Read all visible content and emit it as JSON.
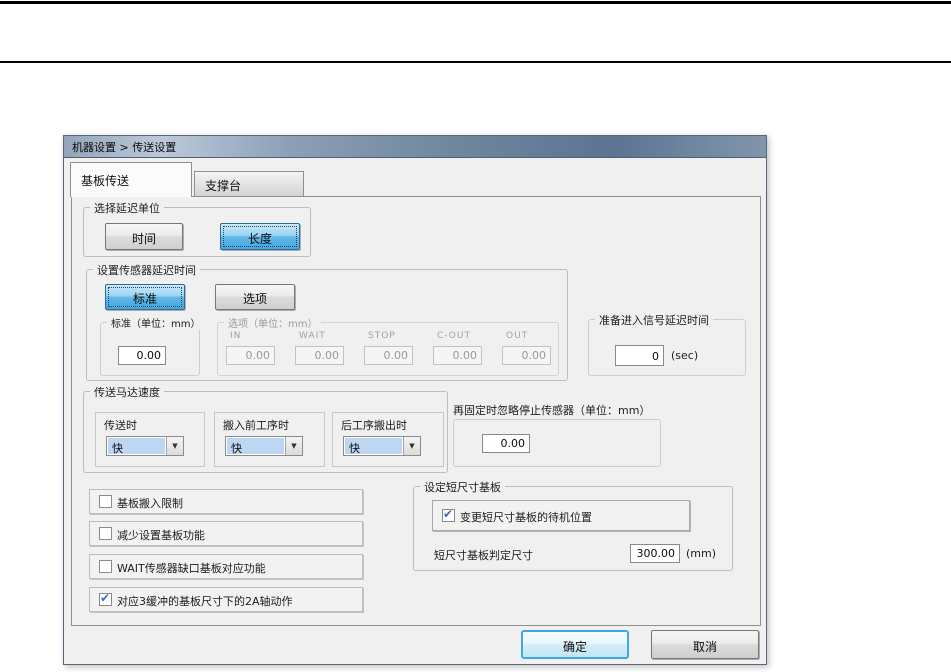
{
  "window": {
    "title": "机器设置 > 传送设置",
    "tabs": {
      "board_transfer": "基板传送",
      "support_table": "支撑台"
    }
  },
  "delay_unit_group": {
    "title": "选择延迟单位",
    "time_button": "时间",
    "length_button": "长度"
  },
  "sensor_delay_group": {
    "title": "设置传感器延迟时间",
    "standard_button": "标准",
    "option_button": "选项",
    "standard_sub": {
      "title": "标准（单位：mm）",
      "value": "0.00"
    },
    "option_sub": {
      "title": "选项（单位：mm）",
      "fields": [
        {
          "label": "IN",
          "value": "0.00"
        },
        {
          "label": "WAIT",
          "value": "0.00"
        },
        {
          "label": "STOP",
          "value": "0.00"
        },
        {
          "label": "C-OUT",
          "value": "0.00"
        },
        {
          "label": "OUT",
          "value": "0.00"
        }
      ]
    }
  },
  "ready_signal_group": {
    "title": "准备进入信号延迟时间",
    "value": "0",
    "unit": "(sec)"
  },
  "motor_speed_group": {
    "title": "传送马达速度",
    "dropdowns": [
      {
        "label": "传送时",
        "value": "快"
      },
      {
        "label": "搬入前工序时",
        "value": "快"
      },
      {
        "label": "后工序搬出时",
        "value": "快"
      }
    ],
    "dropdown_arrow": "▼"
  },
  "refix_group": {
    "title": "再固定时忽略停止传感器（单位：mm）",
    "value": "0.00"
  },
  "checkboxes": [
    {
      "label": "基板搬入限制",
      "checked": false
    },
    {
      "label": "减少设置基板功能",
      "checked": false
    },
    {
      "label": "WAIT传感器缺口基板对应功能",
      "checked": false
    },
    {
      "label": "对应3缓冲的基板尺寸下的2A轴动作",
      "checked": true
    }
  ],
  "short_board_group": {
    "title": "设定短尺寸基板",
    "standby_checkbox": {
      "label": "变更短尺寸基板的待机位置",
      "checked": true
    },
    "judge_size": {
      "label": "短尺寸基板判定尺寸",
      "value": "300.00",
      "unit": "(mm)"
    }
  },
  "footer": {
    "ok": "确定",
    "cancel": "取消"
  },
  "colors": {
    "accent_blue": "#46a6dd",
    "selection_blue": "#bdd7f2",
    "ok_border": "#42a8e0",
    "titlebar_blue": "#70879f"
  }
}
